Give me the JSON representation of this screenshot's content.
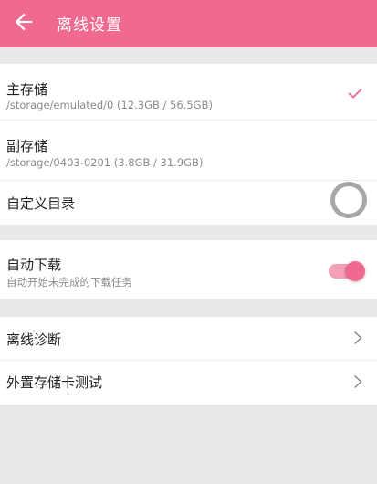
{
  "appbar": {
    "title": "离线设置",
    "back_icon": "arrow-left-icon",
    "color": "#f06a90"
  },
  "storage": {
    "primary": {
      "label": "主存储",
      "path": "/storage/emulated/0 (12.3GB / 56.5GB)",
      "selected": true
    },
    "secondary": {
      "label": "副存储",
      "path": "/storage/0403-0201 (3.8GB / 31.9GB)",
      "selected": false
    },
    "custom": {
      "label": "自定义目录"
    }
  },
  "auto_download": {
    "label": "自动下载",
    "description": "自动开始未完成的下载任务",
    "enabled": true
  },
  "tools": {
    "diagnose_label": "离线诊断",
    "sdcard_test_label": "外置存储卡测试"
  }
}
